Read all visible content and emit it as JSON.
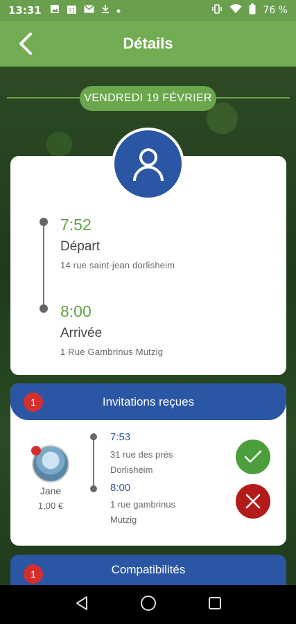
{
  "status_bar": {
    "time": "13:31",
    "battery": "76 %",
    "icons_left": [
      "image-icon",
      "calendar-icon",
      "mail-icon",
      "download-icon",
      "dot-icon"
    ],
    "calendar_day": "31"
  },
  "header": {
    "title": "Détails"
  },
  "date_chip": "VENDREDI 19 FÉVRIER",
  "trip": {
    "departure_time": "7:52",
    "departure_label": "Départ",
    "departure_address": "14 rue saint-jean dorlisheim",
    "arrival_time": "8:00",
    "arrival_label": "Arrivée",
    "arrival_address": "1 Rue Gambrinus Mutzig"
  },
  "invitations": {
    "title": "Invitations reçues",
    "count": "1",
    "user_name": "Jane",
    "price": "1,00 €",
    "pickup_time": "7:53",
    "pickup_address_line1": "31 rue des prés",
    "pickup_address_line2": "Dorlisheim",
    "dropoff_time": "8:00",
    "dropoff_address_line1": "1 rue gambrinus",
    "dropoff_address_line2": "Mutzig"
  },
  "compatibilities": {
    "title": "Compatibilités",
    "count": "1"
  },
  "colors": {
    "header_green": "#72ac53",
    "accent_blue": "#2a56a4",
    "time_green": "#5ea444",
    "badge_red": "#d32f2f",
    "accept_green": "#4b9e3b",
    "decline_red": "#b31b1b"
  }
}
